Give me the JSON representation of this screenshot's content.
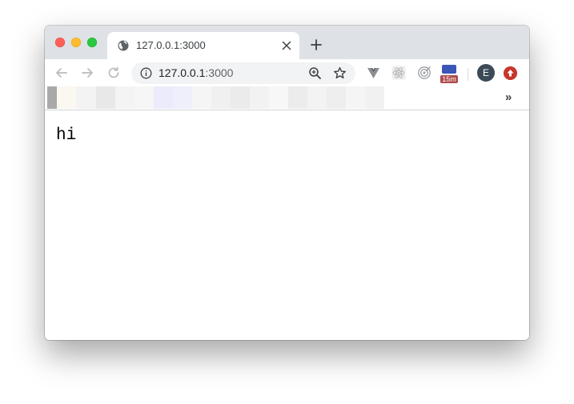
{
  "tab": {
    "title": "127.0.0.1:3000"
  },
  "address_bar": {
    "host": "127.0.0.1",
    "port": ":3000"
  },
  "extensions": [
    {
      "name": "vue-devtools-icon"
    },
    {
      "name": "react-devtools-icon"
    },
    {
      "name": "target-extension-icon"
    },
    {
      "name": "timer-extension-icon",
      "badge": "15m"
    }
  ],
  "profile": {
    "initial": "E"
  },
  "bookmarks_bar": {
    "overflow_label": "»"
  },
  "page": {
    "body_text": "hi"
  },
  "colors": {
    "tabstrip_bg": "#dee1e6",
    "avatar_bg": "#3c4a57",
    "update_red": "#c5362b",
    "badge_red": "#b04a4a"
  }
}
